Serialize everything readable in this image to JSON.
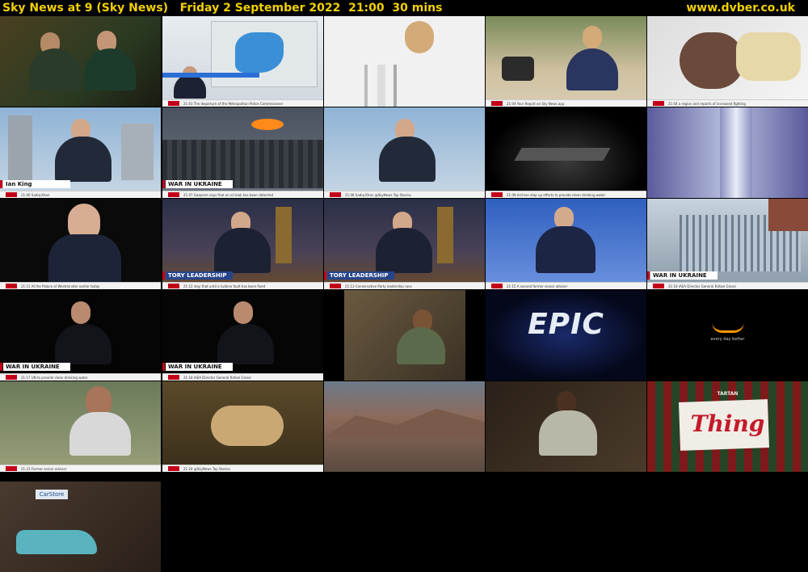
{
  "header": {
    "title": "Sky News at 9 (Sky News)   Friday 2 September 2022  21:00  30 mins",
    "site": "www.dvber.co.uk"
  },
  "thumbnails": [
    {
      "name": "thumb-1",
      "lt": "",
      "ticker": ""
    },
    {
      "name": "thumb-2",
      "lt": "",
      "ticker": "21:01  The departure of the Metropolitan Police Commissioner"
    },
    {
      "name": "thumb-3",
      "lt": "",
      "ticker": ""
    },
    {
      "name": "thumb-4",
      "lt": "",
      "ticker": "21:04  Your Report on Sky News app"
    },
    {
      "name": "thumb-5",
      "lt": "",
      "ticker": "21:04  a region and reports of increased fighting"
    },
    {
      "name": "thumb-6",
      "lt": "Ian King",
      "ticker": "21:06  Sadiq Khan"
    },
    {
      "name": "thumb-7",
      "lt": "WAR IN UKRAINE",
      "ticker": "21:07  Gazprom says that an oil leak has been detected"
    },
    {
      "name": "thumb-8",
      "lt": "",
      "ticker": "21:08  Sadiq Khan  @SkyNews  Top Stories"
    },
    {
      "name": "thumb-9",
      "lt": "",
      "ticker": "21:09  Archive step up efforts to provide clean drinking water"
    },
    {
      "name": "thumb-10",
      "lt": "",
      "ticker": ""
    },
    {
      "name": "thumb-11",
      "lt": "",
      "ticker": "21:11  At the Palace of Westminster earlier today"
    },
    {
      "name": "thumb-12",
      "lt": "TORY LEADERSHIP",
      "ticker": "21:12  stay that until a turbine fault has been fixed"
    },
    {
      "name": "thumb-13",
      "lt": "TORY LEADERSHIP",
      "ticker": "21:13  Conservative Party leadership race"
    },
    {
      "name": "thumb-14",
      "lt": "",
      "ticker": "21:15  A second former senior adviser"
    },
    {
      "name": "thumb-15",
      "lt": "WAR IN UKRAINE",
      "ticker": "21:16  IAEA Director General Rafael Grossi"
    },
    {
      "name": "thumb-16",
      "lt": "WAR IN UKRAINE",
      "ticker": "21:17  UN to provide clean drinking water"
    },
    {
      "name": "thumb-17",
      "lt": "WAR IN UKRAINE",
      "ticker": "21:18  IAEA Director General Rafael Grossi"
    },
    {
      "name": "thumb-18",
      "lt": "",
      "ticker": ""
    },
    {
      "name": "thumb-19",
      "lt": "",
      "ticker": ""
    },
    {
      "name": "thumb-20",
      "lt": "",
      "ticker": ""
    },
    {
      "name": "thumb-21",
      "lt": "",
      "ticker": "21:23  Former senior adviser"
    },
    {
      "name": "thumb-22",
      "lt": "",
      "ticker": "21:24  @SkyNews  Top Stories"
    },
    {
      "name": "thumb-23",
      "lt": "",
      "ticker": ""
    },
    {
      "name": "thumb-24",
      "lt": "",
      "ticker": ""
    },
    {
      "name": "thumb-25",
      "lt": "",
      "ticker": ""
    },
    {
      "name": "thumb-26",
      "lt": "",
      "ticker": ""
    }
  ],
  "logos": {
    "epic": "EPIC",
    "amazon_tagline": "every day better",
    "thing": "Thing",
    "tartan": "TARTAN",
    "carstore": "CarStore"
  },
  "colors": {
    "header_text": "#f2d000",
    "sky_red": "#c4001a"
  }
}
